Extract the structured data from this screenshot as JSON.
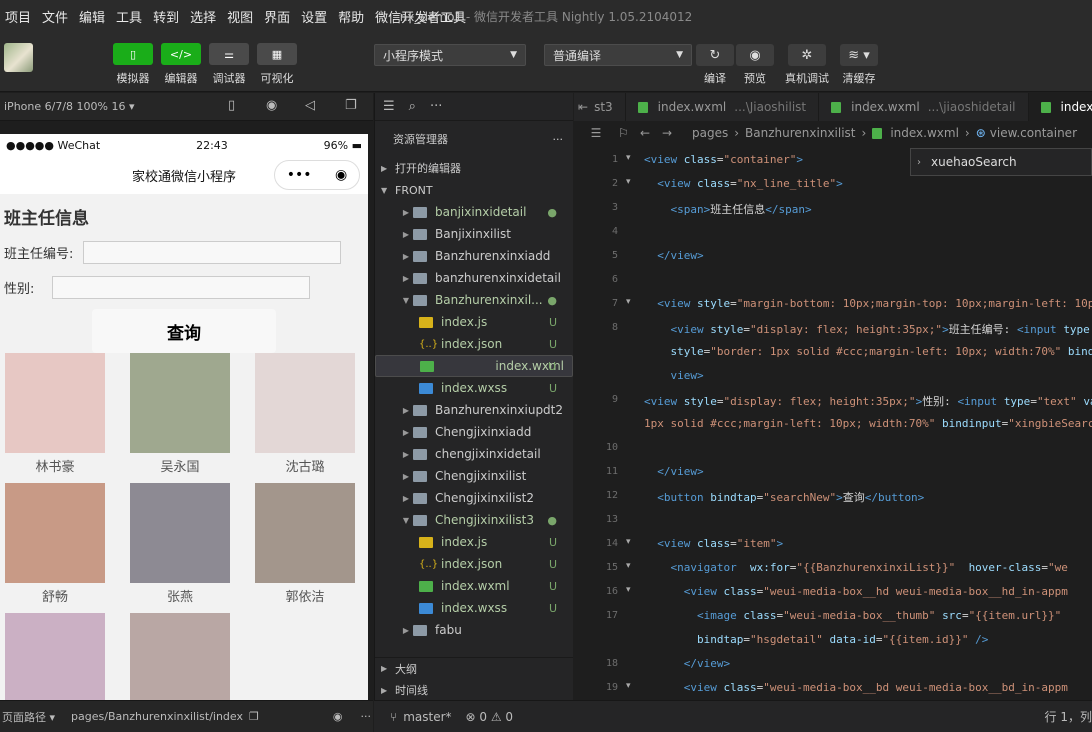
{
  "menu": [
    "项目",
    "文件",
    "编辑",
    "工具",
    "转到",
    "选择",
    "视图",
    "界面",
    "设置",
    "帮助",
    "微信开发者工具"
  ],
  "window_title": {
    "project": "nx_demo1",
    "rest": " - 微信开发者工具 Nightly 1.05.2104012"
  },
  "toolbar": {
    "simulator": "模拟器",
    "editor": "编辑器",
    "debugger": "调试器",
    "visual": "可视化",
    "mode": "小程序模式",
    "compile": "普通编译",
    "compile_btn": "编译",
    "preview": "预览",
    "remote_debug": "真机调试",
    "clear_cache": "清缓存"
  },
  "simbar": {
    "device": "iPhone 6/7/8 100% 16 ▾"
  },
  "phone": {
    "carrier": "●●●●● WeChat",
    "time": "22:43",
    "battery": "96%",
    "nav_title": "家校通微信小程序",
    "page_title": "班主任信息",
    "label_id": "班主任编号:",
    "label_gender": "性别:",
    "search_btn": "查询",
    "cards": [
      {
        "name": "林书豪",
        "tone": "#e7c8c4"
      },
      {
        "name": "吴永国",
        "tone": "#9fa88f"
      },
      {
        "name": "沈古璐",
        "tone": "#e3d7d6"
      },
      {
        "name": "舒畅",
        "tone": "#c89a86"
      },
      {
        "name": "张燕",
        "tone": "#8d8a93"
      },
      {
        "name": "郭依洁",
        "tone": "#a3968c"
      },
      {
        "name": "",
        "tone": "#cbb0c4"
      },
      {
        "name": "",
        "tone": "#b9a7a4"
      }
    ]
  },
  "sim_footer": {
    "label": "页面路径 ▾",
    "path": "pages/Banzhurenxinxilist/index"
  },
  "explorer": {
    "title": "资源管理器",
    "open_editors": "打开的编辑器",
    "root": "FRONT",
    "items": [
      {
        "label": "banjixinxidetail",
        "kind": "folder",
        "status": "●",
        "color": "#7aa66b"
      },
      {
        "label": "Banjixinxilist",
        "kind": "folder"
      },
      {
        "label": "Banzhurenxinxiadd",
        "kind": "folder"
      },
      {
        "label": "banzhurenxinxidetail",
        "kind": "folder"
      },
      {
        "label": "Banzhurenxinxil...",
        "kind": "folder-open",
        "status": "●",
        "color": "#7aa66b"
      },
      {
        "label": "index.js",
        "kind": "js",
        "status": "U",
        "color": "#7aa66b"
      },
      {
        "label": "index.json",
        "kind": "json",
        "status": "U",
        "color": "#7aa66b"
      },
      {
        "label": "index.wxml",
        "kind": "wxml",
        "status": "U",
        "color": "#7aa66b",
        "selected": true
      },
      {
        "label": "index.wxss",
        "kind": "wxss",
        "status": "U",
        "color": "#7aa66b"
      },
      {
        "label": "Banzhurenxinxiupdt2",
        "kind": "folder"
      },
      {
        "label": "Chengjixinxiadd",
        "kind": "folder"
      },
      {
        "label": "chengjixinxidetail",
        "kind": "folder"
      },
      {
        "label": "Chengjixinxilist",
        "kind": "folder"
      },
      {
        "label": "Chengjixinxilist2",
        "kind": "folder"
      },
      {
        "label": "Chengjixinxilist3",
        "kind": "folder-open",
        "status": "●",
        "color": "#7aa66b"
      },
      {
        "label": "index.js",
        "kind": "js",
        "status": "U",
        "color": "#7aa66b"
      },
      {
        "label": "index.json",
        "kind": "json",
        "status": "U",
        "color": "#7aa66b"
      },
      {
        "label": "index.wxml",
        "kind": "wxml",
        "status": "U",
        "color": "#7aa66b"
      },
      {
        "label": "index.wxss",
        "kind": "wxss",
        "status": "U",
        "color": "#7aa66b"
      },
      {
        "label": "fabu",
        "kind": "folder"
      }
    ],
    "outline": "大纲",
    "timeline": "时间线"
  },
  "tabs": [
    {
      "label": "st3",
      "dir": ""
    },
    {
      "label": "index.wxml",
      "dir": "...\\Jiaoshilist"
    },
    {
      "label": "index.wxml",
      "dir": "...\\jiaoshidetail"
    },
    {
      "label": "index.wx",
      "dir": "",
      "active": true
    }
  ],
  "breadcrumb": {
    "pages": "pages",
    "folder": "Banzhurenxinxilist",
    "file": "index.wxml",
    "node": "view.container"
  },
  "suggestion": "xuehaoSearch",
  "code_lines": [
    {
      "n": "1",
      "html": "<span class='t'>&lt;view</span> <span class='a'>class</span>=<span class='s'>\"container\"</span><span class='t'>&gt;</span>"
    },
    {
      "n": "2",
      "html": "  <span class='t'>&lt;view</span> <span class='a'>class</span>=<span class='s'>\"nx_line_title\"</span><span class='t'>&gt;</span>"
    },
    {
      "n": "3",
      "html": "    <span class='t'>&lt;span&gt;</span>班主任信息<span class='t'>&lt;/span&gt;</span>"
    },
    {
      "n": "4",
      "html": ""
    },
    {
      "n": "5",
      "html": "  <span class='t'>&lt;/view&gt;</span>"
    },
    {
      "n": "6",
      "html": ""
    },
    {
      "n": "7",
      "html": "  <span class='t'>&lt;view</span> <span class='a'>style</span>=<span class='s'>\"margin-bottom: 10px;margin-top: 10px;margin-left: 10p</span>"
    },
    {
      "n": "8",
      "html": "    <span class='t'>&lt;view</span> <span class='a'>style</span>=<span class='s'>\"display: flex; height:35px;\"</span><span class='t'>&gt;</span>班主任编号: <span class='t'>&lt;input</span> <span class='a'>type</span>"
    },
    {
      "n": "",
      "html": "    <span class='a'>style</span>=<span class='s'>\"border: 1px solid #ccc;margin-left: 10px; width:70%\"</span> <span class='a'>bind</span>"
    },
    {
      "n": "",
      "html": "    <span class='t'>view&gt;</span>"
    },
    {
      "n": "9",
      "html": "<span class='t'>&lt;view</span> <span class='a'>style</span>=<span class='s'>\"display: flex; height:35px;\"</span><span class='t'>&gt;</span>性别: <span class='t'>&lt;input</span> <span class='a'>type</span>=<span class='s'>\"text\"</span> <span class='a'>va</span>"
    },
    {
      "n": "",
      "html": "<span class='s'>1px solid #ccc;margin-left: 10px; width:70%\"</span> <span class='a'>bindinput</span>=<span class='s'>\"xingbieSearc</span>"
    },
    {
      "n": "10",
      "html": ""
    },
    {
      "n": "11",
      "html": "  <span class='t'>&lt;/view&gt;</span>"
    },
    {
      "n": "12",
      "html": "  <span class='t'>&lt;button</span> <span class='a'>bindtap</span>=<span class='s'>\"searchNew\"</span><span class='t'>&gt;</span>查询<span class='t'>&lt;/button&gt;</span>"
    },
    {
      "n": "13",
      "html": ""
    },
    {
      "n": "14",
      "html": "  <span class='t'>&lt;view</span> <span class='a'>class</span>=<span class='s'>\"item\"</span><span class='t'>&gt;</span>"
    },
    {
      "n": "15",
      "html": "    <span class='t'>&lt;navigator</span>  <span class='a'>wx:for</span>=<span class='s'>\"{{BanzhurenxinxiList}}\"</span>  <span class='a'>hover-class</span>=<span class='s'>\"we</span>"
    },
    {
      "n": "16",
      "html": "      <span class='t'>&lt;view</span> <span class='a'>class</span>=<span class='s'>\"weui-media-box__hd weui-media-box__hd_in-appm</span>"
    },
    {
      "n": "17",
      "html": "        <span class='t'>&lt;image</span> <span class='a'>class</span>=<span class='s'>\"weui-media-box__thumb\"</span> <span class='a'>src</span>=<span class='s'>\"{{item.url}}\"</span>"
    },
    {
      "n": "",
      "html": "        <span class='a'>bindtap</span>=<span class='s'>\"hsgdetail\"</span> <span class='a'>data-id</span>=<span class='s'>\"{{item.id}}\"</span> <span class='t'>/&gt;</span>"
    },
    {
      "n": "18",
      "html": "      <span class='t'>&lt;/view&gt;</span>"
    },
    {
      "n": "19",
      "html": "      <span class='t'>&lt;view</span> <span class='a'>class</span>=<span class='s'>\"weui-media-box__bd weui-media-box__bd_in-appm</span>"
    }
  ],
  "statusbar": {
    "branch": "master*",
    "problems": "⊗ 0 ⚠ 0",
    "position": "行 1，列"
  },
  "colors": {
    "green": "#1aad19",
    "toolbar_btn": "#4a4a4a"
  }
}
